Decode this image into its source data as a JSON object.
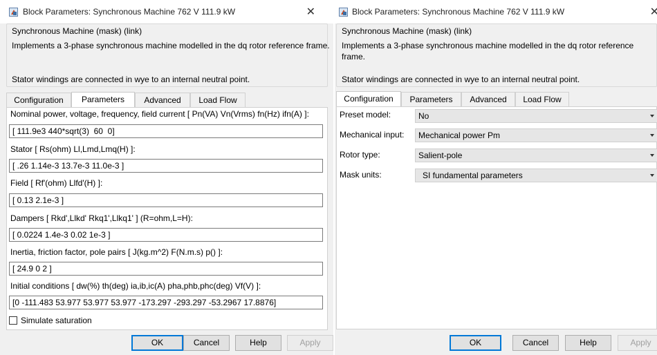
{
  "left_dialog": {
    "title": "Block Parameters: Synchronous Machine 762 V 111.9 kW",
    "mask": {
      "legend": "Synchronous Machine (mask) (link)",
      "description": "Implements a 3-phase synchronous machine modelled in the dq rotor reference frame.",
      "note": "Stator windings are connected in wye to an internal neutral point."
    },
    "tabs": [
      "Configuration",
      "Parameters",
      "Advanced",
      "Load Flow"
    ],
    "active_tab": "Parameters",
    "parameters": [
      {
        "label": "Nominal power, voltage, frequency, field current  [ Pn(VA) Vn(Vrms) fn(Hz) ifn(A) ]:",
        "value": "[ 111.9e3 440*sqrt(3)  60  0]"
      },
      {
        "label": "Stator  [ Rs(ohm)  Ll,Lmd,Lmq(H) ]:",
        "value": "[ .26 1.14e-3 13.7e-3 11.0e-3 ]"
      },
      {
        "label": "Field  [ Rf'(ohm)  Llfd'(H) ]:",
        "value": "[ 0.13 2.1e-3 ]"
      },
      {
        "label": "Dampers   [ Rkd',Llkd'  Rkq1',Llkq1'  ] (R=ohm,L=H):",
        "value": "[ 0.0224 1.4e-3 0.02 1e-3 ]"
      },
      {
        "label": "Inertia, friction factor, pole pairs [ J(kg.m^2)  F(N.m.s)  p() ]:",
        "value": "[ 24.9 0 2 ]"
      },
      {
        "label": "Initial conditions  [ dw(%)  th(deg)  ia,ib,ic(A)  pha,phb,phc(deg)  Vf(V) ]:",
        "value": "[0 -111.483 53.977 53.977 53.977 -173.297 -293.297 -53.2967 17.8876]"
      }
    ],
    "checkbox_label": "Simulate saturation",
    "checkbox_checked": false,
    "buttons": {
      "ok": "OK",
      "cancel": "Cancel",
      "help": "Help",
      "apply": "Apply"
    }
  },
  "right_dialog": {
    "title": "Block Parameters: Synchronous Machine 762 V 111.9 kW",
    "mask": {
      "legend": "Synchronous Machine (mask) (link)",
      "description": "Implements a 3-phase synchronous machine modelled in the dq rotor reference frame.",
      "note": "Stator windings are connected in wye to an internal neutral point."
    },
    "tabs": [
      "Configuration",
      "Parameters",
      "Advanced",
      "Load Flow"
    ],
    "active_tab": "Configuration",
    "configuration": [
      {
        "label": "Preset model:",
        "value": "No"
      },
      {
        "label": "Mechanical input:",
        "value": "Mechanical power Pm"
      },
      {
        "label": "Rotor type:",
        "value": "Salient-pole"
      },
      {
        "label": "Mask units:",
        "value": "SI fundamental parameters"
      }
    ],
    "buttons": {
      "ok": "OK",
      "cancel": "Cancel",
      "help": "Help",
      "apply": "Apply"
    }
  },
  "colors": {
    "dialog_bg": "#f0f0f0",
    "default_button_border": "#0078d7",
    "dropdown_bg": "#e6e6e6",
    "disabled_text": "#a0a0a0"
  },
  "icons": {
    "app_icon": "simulink-block-icon",
    "close": "close-icon",
    "dropdown": "chevron-down-icon"
  }
}
